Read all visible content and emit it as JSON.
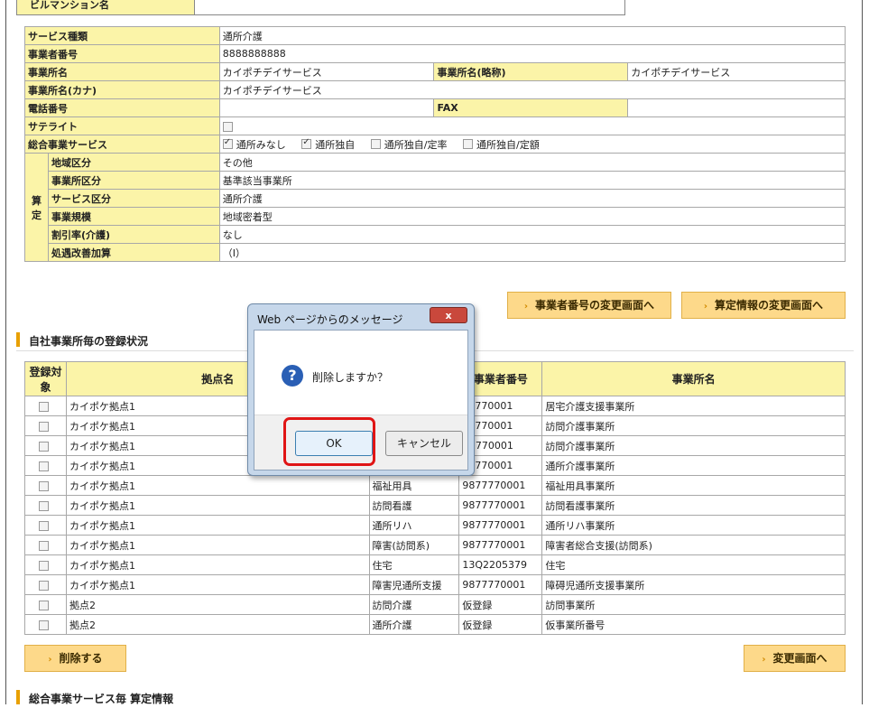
{
  "top_partial_label": "ビルマンション名",
  "info": {
    "service_type": {
      "label": "サービス種類",
      "value": "通所介護"
    },
    "provider_number": {
      "label": "事業者番号",
      "value": "8888888888"
    },
    "office_name": {
      "label": "事業所名",
      "value": "カイポチデイサービス",
      "short_label": "事業所名(略称)",
      "short_value": "カイポチデイサービス"
    },
    "office_kana": {
      "label": "事業所名(カナ)",
      "value": "カイポチデイサービス"
    },
    "phone": {
      "label": "電話番号",
      "value": "",
      "fax_label": "FAX",
      "fax_value": ""
    },
    "satellite": {
      "label": "サテライト"
    },
    "general_service": {
      "label": "総合事業サービス",
      "options": [
        {
          "label": "通所みなし",
          "checked": true
        },
        {
          "label": "通所独自",
          "checked": true
        },
        {
          "label": "通所独自/定率",
          "checked": false
        },
        {
          "label": "通所独自/定額",
          "checked": false
        }
      ]
    },
    "calc_group_label": "算定",
    "calc_rows": [
      {
        "label": "地域区分",
        "value": "その他"
      },
      {
        "label": "事業所区分",
        "value": "基準該当事業所"
      },
      {
        "label": "サービス区分",
        "value": "通所介護"
      },
      {
        "label": "事業規模",
        "value": "地域密着型"
      },
      {
        "label": "割引率(介護)",
        "value": "なし"
      },
      {
        "label": "処遇改善加算",
        "value": "（Ⅰ）"
      }
    ]
  },
  "buttons": {
    "change_provider": "事業者番号の変更画面へ",
    "change_calc": "算定情報の変更画面へ",
    "delete": "削除する",
    "change_screen": "変更画面へ"
  },
  "section_title": "自社事業所毎の登録状況",
  "section_title_bottom": "総合事業サービス毎 算定情報",
  "list": {
    "headers": [
      "登録対象",
      "拠点名",
      "",
      "事業者番号",
      "事業所名"
    ],
    "rows": [
      {
        "base": "カイポケ拠点1",
        "service": "",
        "number": "77770001",
        "office": "居宅介護支援事業所"
      },
      {
        "base": "カイポケ拠点1",
        "service": "",
        "number": "77770001",
        "office": "訪問介護事業所"
      },
      {
        "base": "カイポケ拠点1",
        "service": "",
        "number": "A7770001",
        "office": "訪問介護事業所"
      },
      {
        "base": "カイポケ拠点1",
        "service": "",
        "number": "77770001",
        "office": "通所介護事業所"
      },
      {
        "base": "カイポケ拠点1",
        "service": "福祉用具",
        "number": "9877770001",
        "office": "福祉用具事業所"
      },
      {
        "base": "カイポケ拠点1",
        "service": "訪問看護",
        "number": "9877770001",
        "office": "訪問看護事業所"
      },
      {
        "base": "カイポケ拠点1",
        "service": "通所リハ",
        "number": "9877770001",
        "office": "通所リハ事業所"
      },
      {
        "base": "カイポケ拠点1",
        "service": "障害(訪問系)",
        "number": "9877770001",
        "office": "障害者総合支援(訪問系)"
      },
      {
        "base": "カイポケ拠点1",
        "service": "住宅",
        "number": "13Q2205379",
        "office": "住宅"
      },
      {
        "base": "カイポケ拠点1",
        "service": "障害児通所支援",
        "number": "9877770001",
        "office": "障碍児通所支援事業所"
      },
      {
        "base": "拠点2",
        "service": "訪問介護",
        "number": "仮登録",
        "office": "訪問事業所"
      },
      {
        "base": "拠点2",
        "service": "通所介護",
        "number": "仮登録",
        "office": "仮事業所番号"
      }
    ]
  },
  "dialog": {
    "title": "Web ページからのメッセージ",
    "close": "x",
    "message": "削除しますか？",
    "ok": "OK",
    "cancel": "キャンセル",
    "icon": "question-icon"
  }
}
